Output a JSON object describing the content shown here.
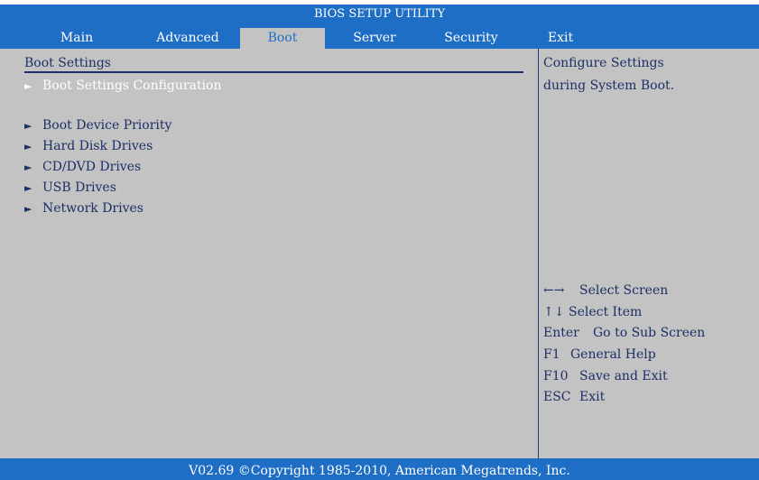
{
  "title": "BIOS SETUP UTILITY",
  "menu": {
    "tabs": [
      {
        "label": "Main"
      },
      {
        "label": "Advanced"
      },
      {
        "label": "Boot"
      },
      {
        "label": "Server"
      },
      {
        "label": "Security"
      },
      {
        "label": "Exit"
      }
    ],
    "active": "Boot"
  },
  "main": {
    "section_title": "Boot Settings",
    "items": [
      {
        "label": "Boot Settings Configuration",
        "arrow": "►",
        "highlighted": true
      },
      {
        "label": "Boot Device Priority",
        "arrow": "►",
        "highlighted": false
      },
      {
        "label": "Hard Disk Drives",
        "arrow": "►",
        "highlighted": false
      },
      {
        "label": "CD/DVD Drives",
        "arrow": "►",
        "highlighted": false
      },
      {
        "label": "USB Drives",
        "arrow": "►",
        "highlighted": false
      },
      {
        "label": "Network Drives",
        "arrow": "►",
        "highlighted": false
      }
    ]
  },
  "help": {
    "line1": "Configure Settings",
    "line2": "during System Boot."
  },
  "keys": [
    {
      "key": "←→",
      "action": "Select Screen"
    },
    {
      "key": "↑↓",
      "action": "Select Item"
    },
    {
      "key": "Enter",
      "action": "Go to Sub Screen"
    },
    {
      "key": "F1",
      "action": "General Help"
    },
    {
      "key": "F10",
      "action": "Save and Exit"
    },
    {
      "key": "ESC",
      "action": "Exit"
    }
  ],
  "footer": "V02.69 ©Copyright 1985-2010, American Megatrends, Inc.",
  "colors": {
    "bar_blue": "#1f6ec6",
    "panel_grey": "#c3c3c3",
    "text_navy": "#1c2f66",
    "highlight_text": "#ffffff"
  }
}
